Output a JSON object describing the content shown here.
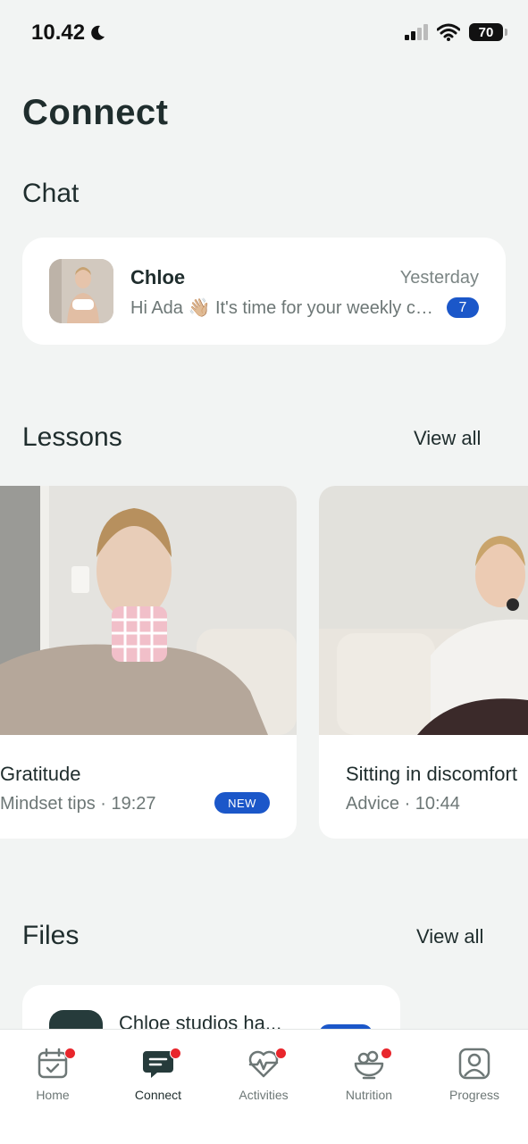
{
  "status_bar": {
    "time": "10.42",
    "battery": "70"
  },
  "page_title": "Connect",
  "chat": {
    "heading": "Chat",
    "name": "Chloe",
    "time": "Yesterday",
    "message": "Hi Ada 👋🏼 It's time for your weekly check-in",
    "unread": "7"
  },
  "lessons": {
    "heading": "Lessons",
    "view_all": "View all",
    "items": [
      {
        "title": "Gratitude",
        "meta": "Mindset tips · 19:27",
        "badge": "NEW"
      },
      {
        "title": "Sitting in discomfort",
        "meta": "Advice · 10:44"
      }
    ]
  },
  "files": {
    "heading": "Files",
    "view_all": "View all",
    "items": [
      {
        "name": "Chloe studios ha..."
      }
    ]
  },
  "tabbar": {
    "items": [
      {
        "label": "Home",
        "icon": "calendar-check-icon",
        "active": false,
        "dot": true
      },
      {
        "label": "Connect",
        "icon": "chat-bubble-icon",
        "active": true,
        "dot": true
      },
      {
        "label": "Activities",
        "icon": "heart-pulse-icon",
        "active": false,
        "dot": true
      },
      {
        "label": "Nutrition",
        "icon": "salad-bowl-icon",
        "active": false,
        "dot": true
      },
      {
        "label": "Progress",
        "icon": "user-profile-icon",
        "active": false,
        "dot": false
      }
    ]
  },
  "colors": {
    "accent": "#1b57c9",
    "notification": "#e8262c",
    "background": "#f2f4f3",
    "text": "#1f2d2d"
  }
}
